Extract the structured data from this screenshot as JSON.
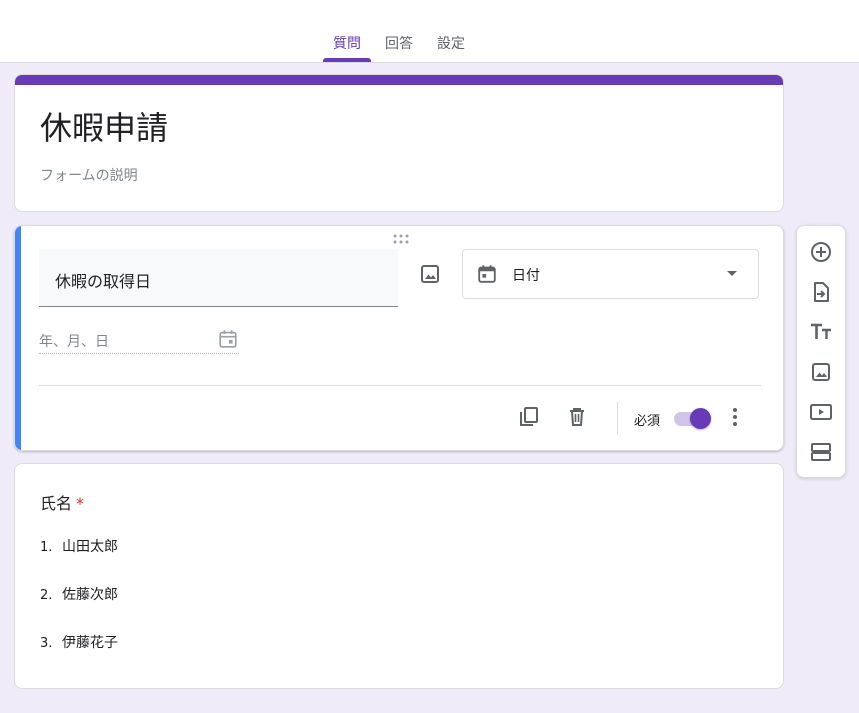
{
  "tabs": [
    {
      "label": "質問",
      "active": true
    },
    {
      "label": "回答",
      "active": false
    },
    {
      "label": "設定",
      "active": false
    }
  ],
  "form": {
    "title": "休暇申請",
    "description_placeholder": "フォームの説明"
  },
  "question": {
    "title": "休暇の取得日",
    "type_label": "日付",
    "date_placeholder": "年、月、日",
    "required_label": "必須",
    "required_on": true
  },
  "name_question": {
    "title": "氏名",
    "required_mark": "*",
    "options": [
      {
        "num": "1.",
        "text": "山田太郎"
      },
      {
        "num": "2.",
        "text": "佐藤次郎"
      },
      {
        "num": "3.",
        "text": "伊藤花子"
      }
    ]
  },
  "side_toolbar": [
    "add-question-icon",
    "import-questions-icon",
    "add-title-icon",
    "add-image-icon",
    "add-video-icon",
    "add-section-icon"
  ],
  "colors": {
    "accent": "#673ab7",
    "focus_bar": "#4285f4",
    "background": "#f0ebf8",
    "required": "#d93025"
  }
}
